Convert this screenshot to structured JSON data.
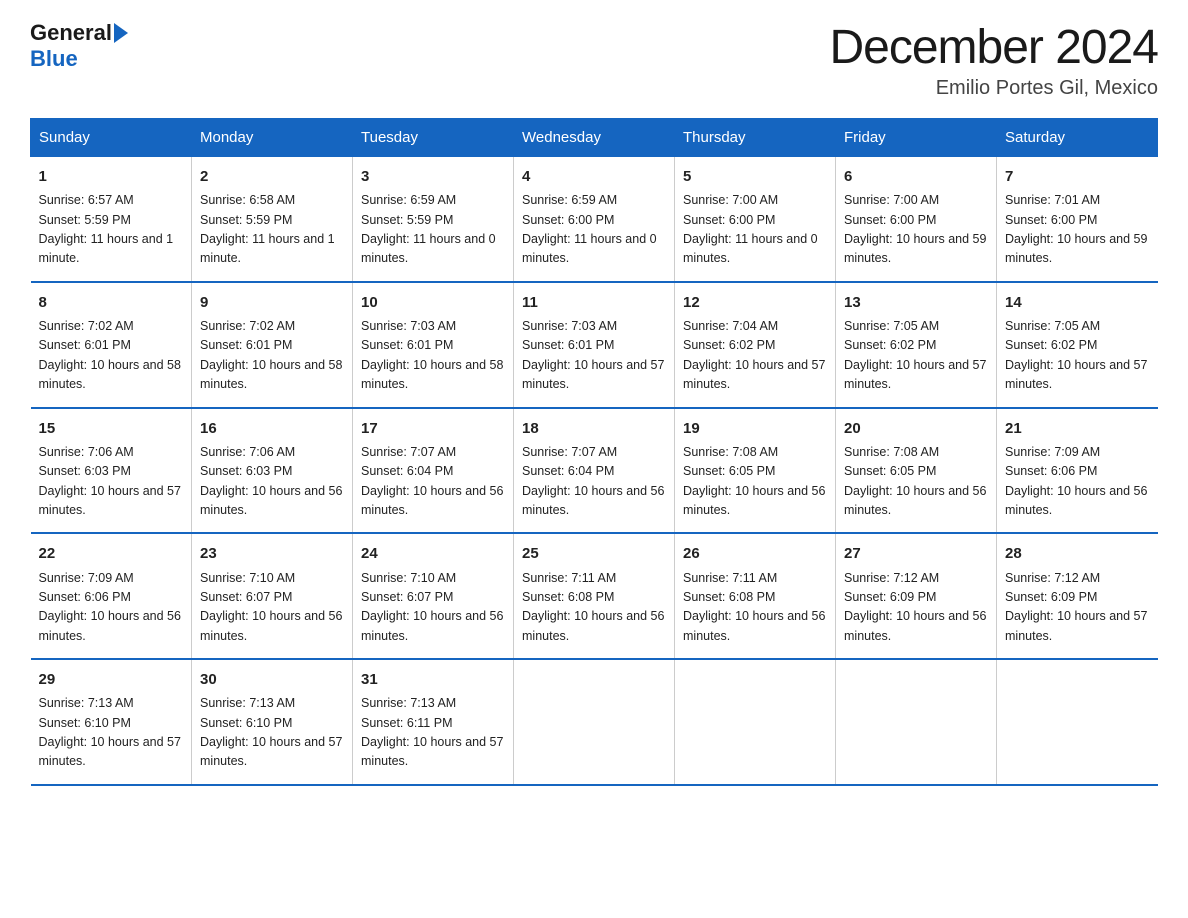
{
  "logo": {
    "text_general": "General",
    "text_blue": "Blue"
  },
  "header": {
    "month": "December 2024",
    "location": "Emilio Portes Gil, Mexico"
  },
  "weekdays": [
    "Sunday",
    "Monday",
    "Tuesday",
    "Wednesday",
    "Thursday",
    "Friday",
    "Saturday"
  ],
  "weeks": [
    [
      {
        "day": 1,
        "sunrise": "6:57 AM",
        "sunset": "5:59 PM",
        "daylight": "11 hours and 1 minute."
      },
      {
        "day": 2,
        "sunrise": "6:58 AM",
        "sunset": "5:59 PM",
        "daylight": "11 hours and 1 minute."
      },
      {
        "day": 3,
        "sunrise": "6:59 AM",
        "sunset": "5:59 PM",
        "daylight": "11 hours and 0 minutes."
      },
      {
        "day": 4,
        "sunrise": "6:59 AM",
        "sunset": "6:00 PM",
        "daylight": "11 hours and 0 minutes."
      },
      {
        "day": 5,
        "sunrise": "7:00 AM",
        "sunset": "6:00 PM",
        "daylight": "11 hours and 0 minutes."
      },
      {
        "day": 6,
        "sunrise": "7:00 AM",
        "sunset": "6:00 PM",
        "daylight": "10 hours and 59 minutes."
      },
      {
        "day": 7,
        "sunrise": "7:01 AM",
        "sunset": "6:00 PM",
        "daylight": "10 hours and 59 minutes."
      }
    ],
    [
      {
        "day": 8,
        "sunrise": "7:02 AM",
        "sunset": "6:01 PM",
        "daylight": "10 hours and 58 minutes."
      },
      {
        "day": 9,
        "sunrise": "7:02 AM",
        "sunset": "6:01 PM",
        "daylight": "10 hours and 58 minutes."
      },
      {
        "day": 10,
        "sunrise": "7:03 AM",
        "sunset": "6:01 PM",
        "daylight": "10 hours and 58 minutes."
      },
      {
        "day": 11,
        "sunrise": "7:03 AM",
        "sunset": "6:01 PM",
        "daylight": "10 hours and 57 minutes."
      },
      {
        "day": 12,
        "sunrise": "7:04 AM",
        "sunset": "6:02 PM",
        "daylight": "10 hours and 57 minutes."
      },
      {
        "day": 13,
        "sunrise": "7:05 AM",
        "sunset": "6:02 PM",
        "daylight": "10 hours and 57 minutes."
      },
      {
        "day": 14,
        "sunrise": "7:05 AM",
        "sunset": "6:02 PM",
        "daylight": "10 hours and 57 minutes."
      }
    ],
    [
      {
        "day": 15,
        "sunrise": "7:06 AM",
        "sunset": "6:03 PM",
        "daylight": "10 hours and 57 minutes."
      },
      {
        "day": 16,
        "sunrise": "7:06 AM",
        "sunset": "6:03 PM",
        "daylight": "10 hours and 56 minutes."
      },
      {
        "day": 17,
        "sunrise": "7:07 AM",
        "sunset": "6:04 PM",
        "daylight": "10 hours and 56 minutes."
      },
      {
        "day": 18,
        "sunrise": "7:07 AM",
        "sunset": "6:04 PM",
        "daylight": "10 hours and 56 minutes."
      },
      {
        "day": 19,
        "sunrise": "7:08 AM",
        "sunset": "6:05 PM",
        "daylight": "10 hours and 56 minutes."
      },
      {
        "day": 20,
        "sunrise": "7:08 AM",
        "sunset": "6:05 PM",
        "daylight": "10 hours and 56 minutes."
      },
      {
        "day": 21,
        "sunrise": "7:09 AM",
        "sunset": "6:06 PM",
        "daylight": "10 hours and 56 minutes."
      }
    ],
    [
      {
        "day": 22,
        "sunrise": "7:09 AM",
        "sunset": "6:06 PM",
        "daylight": "10 hours and 56 minutes."
      },
      {
        "day": 23,
        "sunrise": "7:10 AM",
        "sunset": "6:07 PM",
        "daylight": "10 hours and 56 minutes."
      },
      {
        "day": 24,
        "sunrise": "7:10 AM",
        "sunset": "6:07 PM",
        "daylight": "10 hours and 56 minutes."
      },
      {
        "day": 25,
        "sunrise": "7:11 AM",
        "sunset": "6:08 PM",
        "daylight": "10 hours and 56 minutes."
      },
      {
        "day": 26,
        "sunrise": "7:11 AM",
        "sunset": "6:08 PM",
        "daylight": "10 hours and 56 minutes."
      },
      {
        "day": 27,
        "sunrise": "7:12 AM",
        "sunset": "6:09 PM",
        "daylight": "10 hours and 56 minutes."
      },
      {
        "day": 28,
        "sunrise": "7:12 AM",
        "sunset": "6:09 PM",
        "daylight": "10 hours and 57 minutes."
      }
    ],
    [
      {
        "day": 29,
        "sunrise": "7:13 AM",
        "sunset": "6:10 PM",
        "daylight": "10 hours and 57 minutes."
      },
      {
        "day": 30,
        "sunrise": "7:13 AM",
        "sunset": "6:10 PM",
        "daylight": "10 hours and 57 minutes."
      },
      {
        "day": 31,
        "sunrise": "7:13 AM",
        "sunset": "6:11 PM",
        "daylight": "10 hours and 57 minutes."
      },
      null,
      null,
      null,
      null
    ]
  ]
}
